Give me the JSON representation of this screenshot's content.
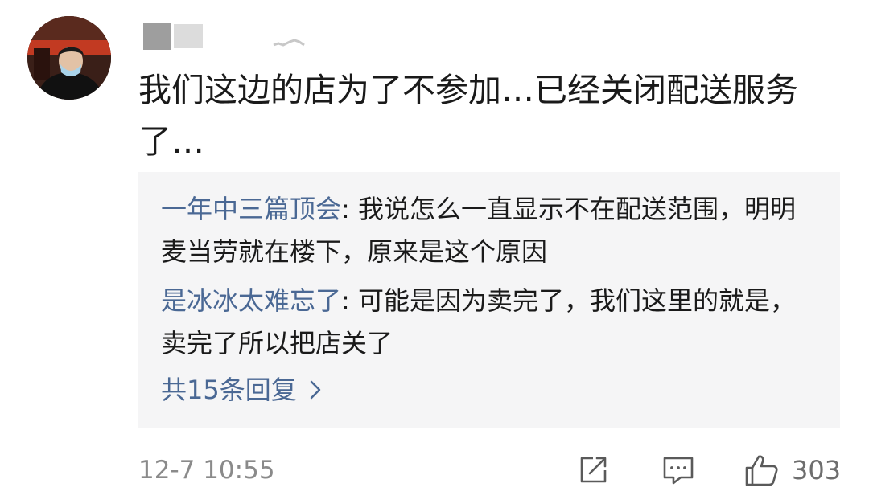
{
  "comment": {
    "text": "我们这边的店为了不参加…已经关闭配送服务了…",
    "replies": [
      {
        "author": "一年中三篇顶会",
        "separator": ": ",
        "text": "我说怎么一直显示不在配送范围，明明麦当劳就在楼下，原来是这个原因"
      },
      {
        "author": "是冰冰太难忘了",
        "separator": ": ",
        "text": "可能是因为卖完了，我们这里的就是，卖完了所以把店关了"
      }
    ],
    "more_replies_label": "共15条回复",
    "timestamp": "12-7 10:55",
    "like_count": "303"
  },
  "colors": {
    "link": "#4a6894",
    "text": "#1a1a1a",
    "meta": "#8a8a8a",
    "reply_bg": "#f5f5f6"
  },
  "icons": {
    "share": "share-icon",
    "comment": "comment-icon",
    "like": "thumbs-up-icon",
    "chevron": "chevron-right-icon"
  }
}
